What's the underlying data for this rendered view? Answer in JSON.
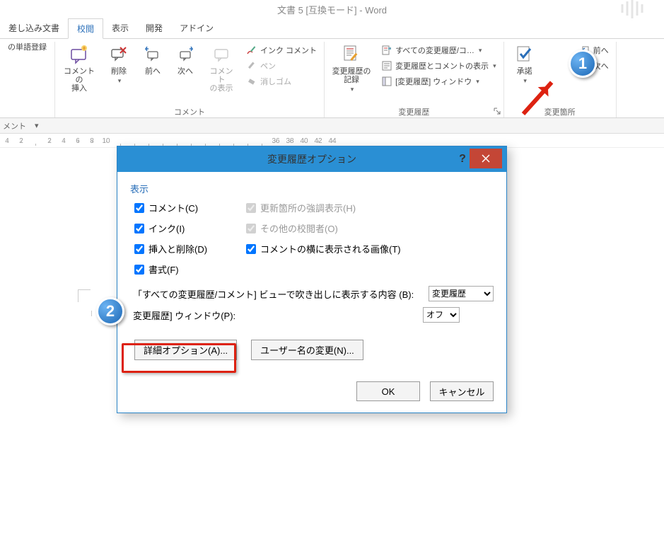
{
  "title": "文書 5 [互換モード] - Word",
  "tabs": {
    "mailings": "差し込み文書",
    "review": "校閲",
    "view": "表示",
    "developer": "開発",
    "addin": "アドイン"
  },
  "ribbon": {
    "group_proofing": {
      "btn1": "の単語登録"
    },
    "group_comments": {
      "label": "コメント",
      "new": "コメントの\n挿入",
      "del": "削除",
      "prev": "前へ",
      "next": "次へ",
      "show": "コメント\nの表示",
      "ink_comment": "インク コメント",
      "pen": "ペン",
      "eraser": "消しゴム"
    },
    "group_tracking": {
      "label": "変更履歴",
      "track": "変更履歴の\n記録",
      "display1": "すべての変更履歴/コ…",
      "display2": "変更履歴とコメントの表示",
      "display3": "[変更履歴] ウィンドウ"
    },
    "group_changes": {
      "label": "変更箇所",
      "accept": "承諾",
      "prev": "前へ",
      "next": "次へ"
    }
  },
  "bar_label": "メント",
  "ruler_marks": [
    "4",
    "2",
    "",
    "2",
    "4",
    "6",
    "8",
    "10",
    "",
    "",
    "",
    "",
    "",
    "",
    "",
    "",
    "",
    "",
    "",
    "36",
    "38",
    "40",
    "42",
    "44"
  ],
  "dialog": {
    "title": "変更履歴オプション",
    "section_show": "表示",
    "chk_comment": "コメント(C)",
    "chk_highlight": "更新箇所の強調表示(H)",
    "chk_ink": "インク(I)",
    "chk_others": "その他の校閲者(O)",
    "chk_insdel": "挿入と削除(D)",
    "chk_images": "コメントの横に表示される画像(T)",
    "chk_format": "書式(F)",
    "balloon_label": "「すべての変更履歴/コメント] ビューで吹き出しに表示する内容 (B):",
    "balloon_value": "変更履歴",
    "pane_label": "変更履歴] ウィンドウ(P):",
    "pane_value": "オフ",
    "btn_adv": "詳細オプション(A)...",
    "btn_user": "ユーザー名の変更(N)...",
    "btn_ok": "OK",
    "btn_cancel": "キャンセル"
  }
}
